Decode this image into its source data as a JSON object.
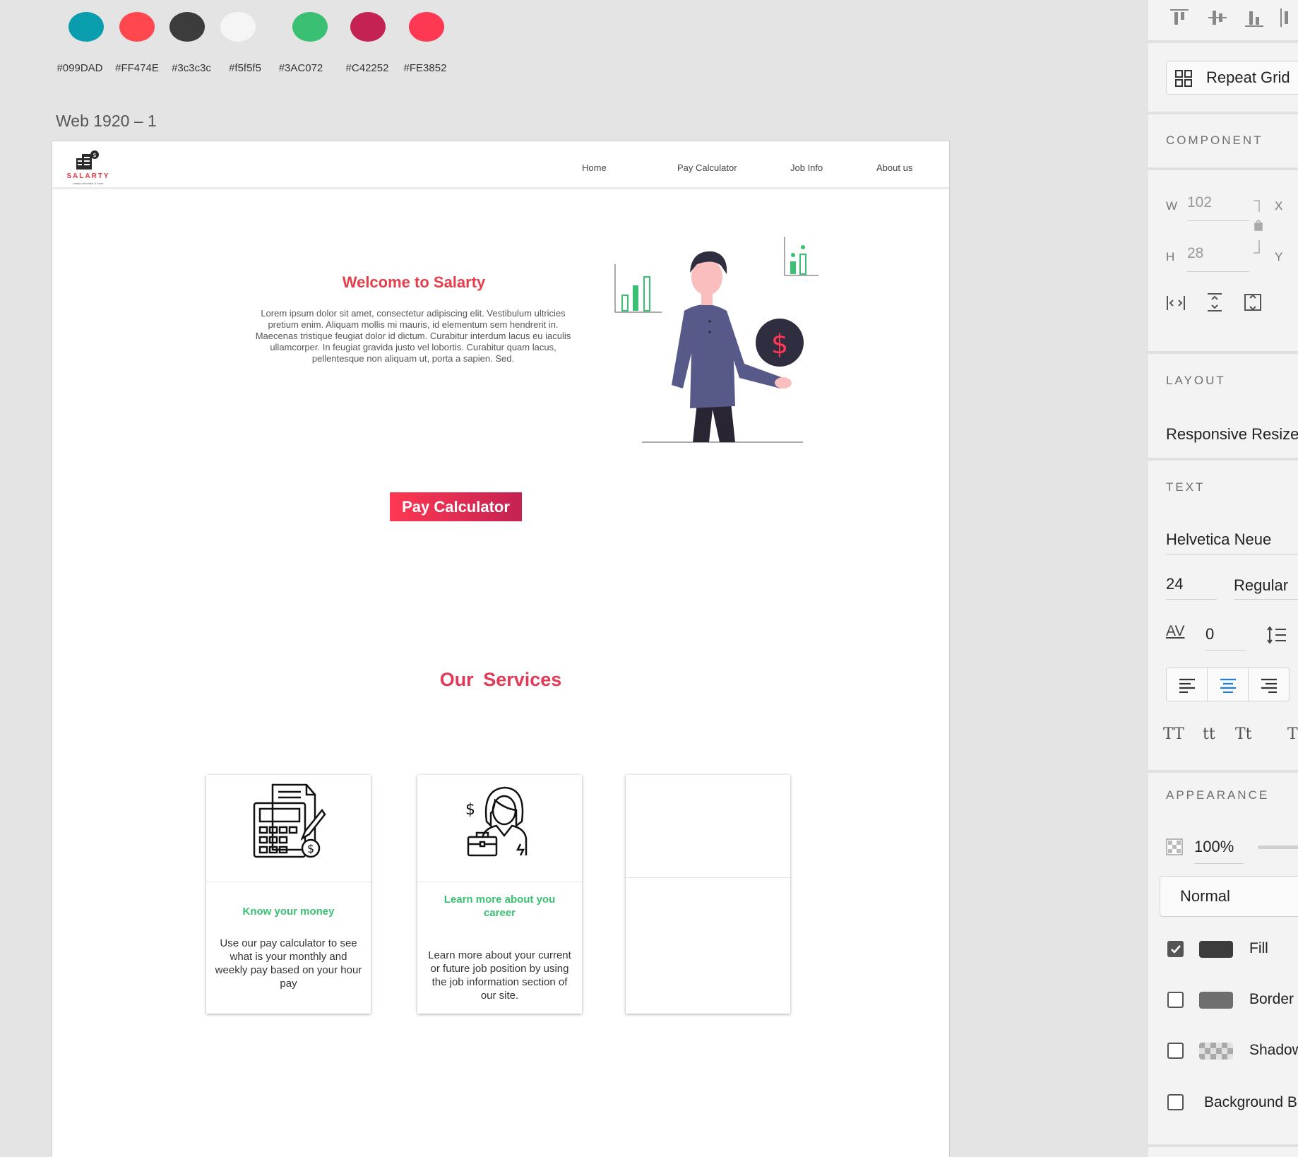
{
  "swatches": [
    {
      "color": "#099DAD",
      "label": "#099DAD"
    },
    {
      "color": "#FF474E",
      "label": "#FF474E"
    },
    {
      "color": "#3c3c3c",
      "label": "#3c3c3c"
    },
    {
      "color": "#f5f5f5",
      "label": "#f5f5f5"
    },
    {
      "color": "#3AC072",
      "label": "#3AC072"
    },
    {
      "color": "#C42252",
      "label": "#C42252"
    },
    {
      "color": "#FE3852",
      "label": "#FE3852"
    }
  ],
  "artboard": {
    "title": "Web 1920 – 1"
  },
  "site": {
    "logo_text": "SALARTY",
    "logo_sub": "salary calculator & more",
    "nav": [
      "Home",
      "Pay Calculator",
      "Job Info",
      "About us"
    ],
    "hero_title": "Welcome to Salarty",
    "hero_text": "Lorem ipsum dolor sit amet, consectetur adipiscing elit. Vestibulum ultricies pretium enim. Aliquam mollis mi mauris, id elementum sem hendrerit in. Maecenas tristique feugiat dolor id dictum. Curabitur interdum lacus eu iaculis ullamcorper. In feugiat gravida justo vel lobortis. Curabitur quam lacus, pellentesque non aliquam ut, porta a sapien. Sed.",
    "cta_label": "Pay Calculator",
    "services_title": "Our Services",
    "cards": [
      {
        "title": "Know your money",
        "text": "Use our pay calculator to see what is your monthly and weekly pay based on your hour pay"
      },
      {
        "title": "Learn more about you career",
        "text": "Learn more about your current or future job position by using the job information section of our site."
      },
      {
        "title": "",
        "text": ""
      }
    ]
  },
  "panel": {
    "repeat_grid": "Repeat Grid",
    "component_heading": "COMPONENT",
    "w_label": "W",
    "w_value": "102",
    "h_label": "H",
    "h_value": "28",
    "x_label": "X",
    "y_label": "Y",
    "layout_heading": "LAYOUT",
    "responsive_resize": "Responsive Resize",
    "text_heading": "TEXT",
    "font_family": "Helvetica Neue",
    "font_size": "24",
    "font_weight": "Regular",
    "char_spacing_label": "AV",
    "char_spacing": "0",
    "text_transforms": [
      "TT",
      "tt",
      "Tt",
      "T"
    ],
    "appearance_heading": "APPEARANCE",
    "opacity": "100%",
    "blend_mode": "Normal",
    "fill_color": "#3c3c3c",
    "border_color": "#6e6e6e",
    "options": [
      {
        "label": "Fill",
        "checked": true
      },
      {
        "label": "Border",
        "checked": false
      },
      {
        "label": "Shadow",
        "checked": false
      },
      {
        "label": "Background Blur",
        "checked": false
      }
    ]
  }
}
